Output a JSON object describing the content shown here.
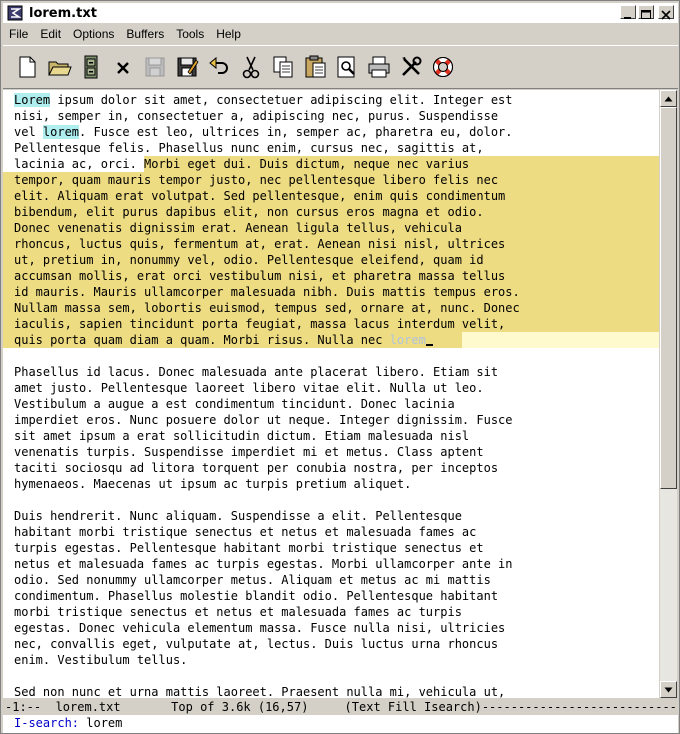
{
  "window": {
    "title": "lorem.txt"
  },
  "menubar": [
    "File",
    "Edit",
    "Options",
    "Buffers",
    "Tools",
    "Help"
  ],
  "toolbar": [
    {
      "name": "new-file-icon"
    },
    {
      "name": "open-folder-icon"
    },
    {
      "name": "dired-cabinet-icon"
    },
    {
      "name": "close-buffer-icon"
    },
    {
      "name": "save-icon",
      "disabled": true
    },
    {
      "name": "save-as-icon"
    },
    {
      "name": "undo-icon"
    },
    {
      "name": "cut-icon"
    },
    {
      "name": "copy-icon"
    },
    {
      "name": "paste-icon"
    },
    {
      "name": "search-icon"
    },
    {
      "name": "print-icon"
    },
    {
      "name": "preferences-icon"
    },
    {
      "name": "help-lifebuoy-icon"
    }
  ],
  "editor": {
    "lines": [
      {
        "segments": [
          {
            "t": "Lorem",
            "c": "isearch"
          },
          {
            "t": " ipsum dolor sit amet, consectetuer adipiscing elit. Integer est"
          }
        ]
      },
      {
        "segments": [
          {
            "t": "nisi, semper in, consectetuer a, adipiscing nec, purus. Suspendisse"
          }
        ]
      },
      {
        "segments": [
          {
            "t": "vel "
          },
          {
            "t": "lorem",
            "c": "isearch"
          },
          {
            "t": ". Fusce est leo, ultrices in, semper ac, pharetra eu, dolor."
          }
        ]
      },
      {
        "segments": [
          {
            "t": "Pellentesque felis. Phasellus nunc enim, cursus nec, sagittis at,"
          }
        ]
      },
      {
        "segments": [
          {
            "t": "lacinia ac, orci. "
          },
          {
            "t": "Morbi eget dui. Duis dictum, neque nec varius",
            "c": "hl"
          }
        ],
        "region": "partial"
      },
      {
        "segments": [
          {
            "t": "tempor, quam mauris tempor justo, nec pellentesque libero felis nec"
          }
        ],
        "region": "full"
      },
      {
        "segments": [
          {
            "t": "elit. Aliquam erat volutpat. Sed pellentesque, enim quis condimentum"
          }
        ],
        "region": "full"
      },
      {
        "segments": [
          {
            "t": "bibendum, elit purus dapibus elit, non cursus eros magna et odio."
          }
        ],
        "region": "full"
      },
      {
        "segments": [
          {
            "t": "Donec venenatis dignissim erat. Aenean ligula tellus, vehicula"
          }
        ],
        "region": "full"
      },
      {
        "segments": [
          {
            "t": "rhoncus, luctus quis, fermentum at, erat. Aenean nisi nisl, ultrices"
          }
        ],
        "region": "full"
      },
      {
        "segments": [
          {
            "t": "ut, pretium in, nonummy vel, odio. Pellentesque eleifend, quam id"
          }
        ],
        "region": "full"
      },
      {
        "segments": [
          {
            "t": "accumsan mollis, erat orci vestibulum nisi, et pharetra massa tellus"
          }
        ],
        "region": "full"
      },
      {
        "segments": [
          {
            "t": "id mauris. Mauris ullamcorper malesuada nibh. Duis mattis tempus eros."
          }
        ],
        "region": "full"
      },
      {
        "segments": [
          {
            "t": "Nullam massa sem, lobortis euismod, tempus sed, ornare at, nunc. Donec"
          }
        ],
        "region": "full"
      },
      {
        "segments": [
          {
            "t": "iaculis, sapien tincidunt porta feugiat, massa lacus interdum velit,"
          }
        ],
        "region": "full"
      },
      {
        "segments": [
          {
            "t": "quis porta quam diam a quam. Morbi risus. Nulla nec "
          },
          {
            "t": "lorem",
            "c": "ghost"
          },
          {
            "t": " ",
            "c": "cursor"
          }
        ],
        "region": "tail"
      },
      {
        "segments": [
          {
            "t": ""
          }
        ]
      },
      {
        "segments": [
          {
            "t": "Phasellus id lacus. Donec malesuada ante placerat libero. Etiam sit"
          }
        ]
      },
      {
        "segments": [
          {
            "t": "amet justo. Pellentesque laoreet libero vitae elit. Nulla ut leo."
          }
        ]
      },
      {
        "segments": [
          {
            "t": "Vestibulum a augue a est condimentum tincidunt. Donec lacinia"
          }
        ]
      },
      {
        "segments": [
          {
            "t": "imperdiet eros. Nunc posuere dolor ut neque. Integer dignissim. Fusce"
          }
        ]
      },
      {
        "segments": [
          {
            "t": "sit amet ipsum a erat sollicitudin dictum. Etiam malesuada nisl"
          }
        ]
      },
      {
        "segments": [
          {
            "t": "venenatis turpis. Suspendisse imperdiet mi et metus. Class aptent"
          }
        ]
      },
      {
        "segments": [
          {
            "t": "taciti sociosqu ad litora torquent per conubia nostra, per inceptos"
          }
        ]
      },
      {
        "segments": [
          {
            "t": "hymenaeos. Maecenas ut ipsum ac turpis pretium aliquet."
          }
        ]
      },
      {
        "segments": [
          {
            "t": ""
          }
        ]
      },
      {
        "segments": [
          {
            "t": "Duis hendrerit. Nunc aliquam. Suspendisse a elit. Pellentesque"
          }
        ]
      },
      {
        "segments": [
          {
            "t": "habitant morbi tristique senectus et netus et malesuada fames ac"
          }
        ]
      },
      {
        "segments": [
          {
            "t": "turpis egestas. Pellentesque habitant morbi tristique senectus et"
          }
        ]
      },
      {
        "segments": [
          {
            "t": "netus et malesuada fames ac turpis egestas. Morbi ullamcorper ante in"
          }
        ]
      },
      {
        "segments": [
          {
            "t": "odio. Sed nonummy ullamcorper metus. Aliquam et metus ac mi mattis"
          }
        ]
      },
      {
        "segments": [
          {
            "t": "condimentum. Phasellus molestie blandit odio. Pellentesque habitant"
          }
        ]
      },
      {
        "segments": [
          {
            "t": "morbi tristique senectus et netus et malesuada fames ac turpis"
          }
        ]
      },
      {
        "segments": [
          {
            "t": "egestas. Donec vehicula elementum massa. Fusce nulla nisi, ultricies"
          }
        ]
      },
      {
        "segments": [
          {
            "t": "nec, convallis eget, vulputate at, lectus. Duis luctus urna rhoncus"
          }
        ]
      },
      {
        "segments": [
          {
            "t": "enim. Vestibulum tellus."
          }
        ]
      },
      {
        "segments": [
          {
            "t": ""
          }
        ]
      },
      {
        "segments": [
          {
            "t": "Sed non nunc et urna mattis laoreet. Praesent nulla mi, vehicula ut,"
          }
        ]
      }
    ]
  },
  "modeline": "-1:--  lorem.txt       Top of 3.6k (16,57)     (Text Fill Isearch)------------------------------",
  "minibuffer": {
    "prompt": "I-search:",
    "query": " lorem"
  },
  "colors": {
    "region": "#eedc82",
    "isearch": "#afeeee",
    "lazy_tail": "#fffacd"
  }
}
